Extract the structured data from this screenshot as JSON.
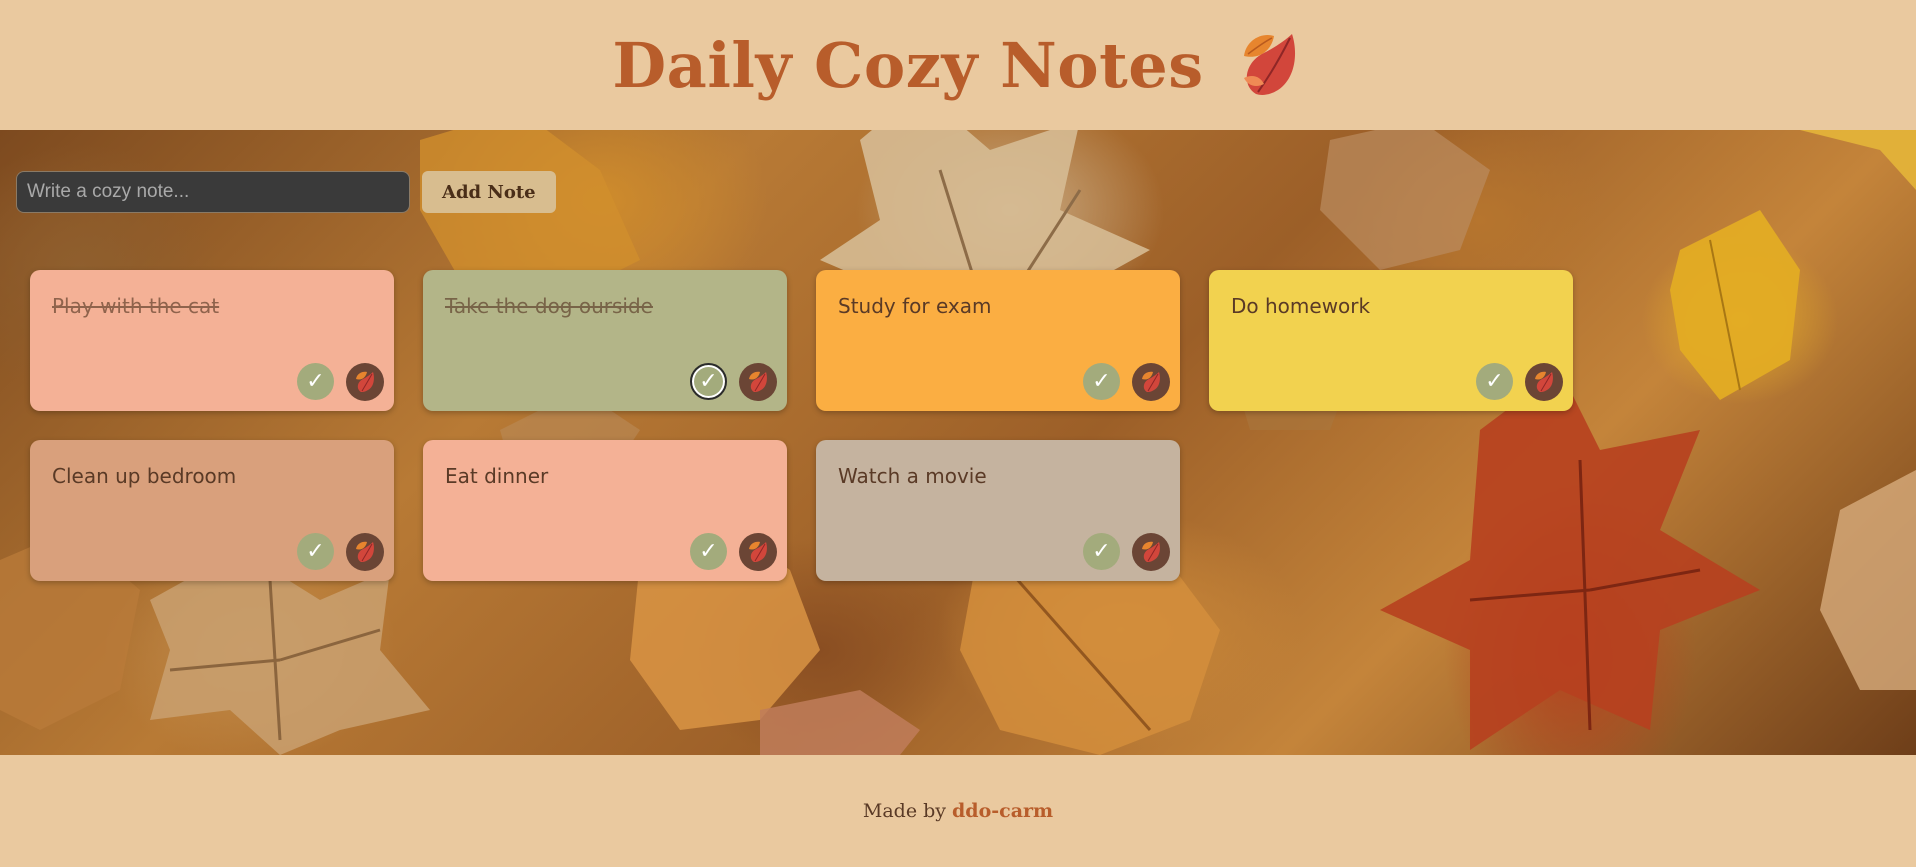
{
  "header": {
    "title": "Daily Cozy Notes",
    "title_icon": "fallen-leaves-icon"
  },
  "composer": {
    "placeholder": "Write a cozy note...",
    "value": "",
    "add_label": "Add Note"
  },
  "colors": {
    "accent": "#b85d2b",
    "background": "#eac99f",
    "check_button": "#a3ab7c",
    "delete_button": "#6b4535"
  },
  "notes": [
    {
      "text": "Play with the cat",
      "done": true,
      "color": "#f4b196"
    },
    {
      "text": "Take the dog ourside",
      "done": true,
      "color": "#b3b588"
    },
    {
      "text": "Study for exam",
      "done": false,
      "color": "#fbae42"
    },
    {
      "text": "Do homework",
      "done": false,
      "color": "#f2d24f"
    },
    {
      "text": "Clean up bedroom",
      "done": false,
      "color": "#d9a07c"
    },
    {
      "text": "Eat dinner",
      "done": false,
      "color": "#f4b196"
    },
    {
      "text": "Watch a movie",
      "done": false,
      "color": "#c5b39f"
    }
  ],
  "note_actions": {
    "complete_icon": "check-icon",
    "complete_glyph": "✓",
    "delete_icon": "leaf-icon"
  },
  "footer": {
    "prefix": "Made by",
    "author": "ddo-carm"
  }
}
